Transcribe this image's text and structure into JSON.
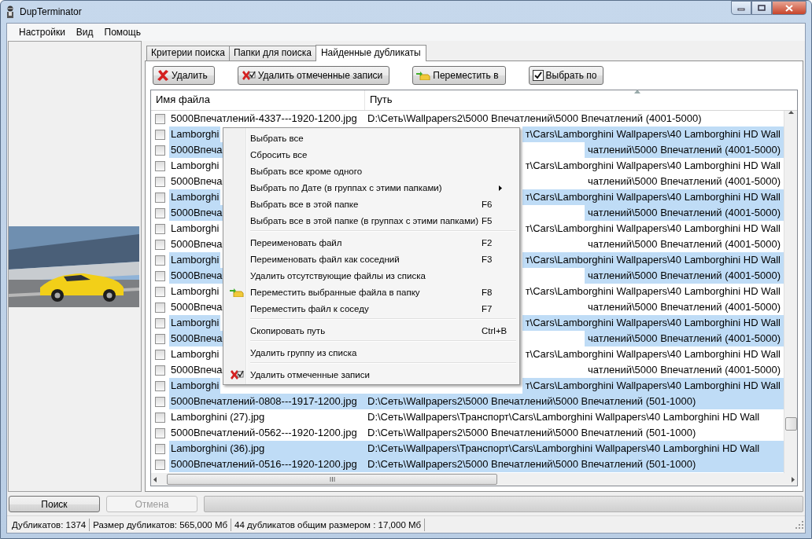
{
  "window": {
    "title": "DupTerminator"
  },
  "menu_bar": [
    "Настройки",
    "Вид",
    "Помощь"
  ],
  "tabs": [
    {
      "label": "Критерии поиска",
      "selected": false
    },
    {
      "label": "Папки для поиска",
      "selected": false
    },
    {
      "label": "Найденные дубликаты",
      "selected": true
    }
  ],
  "toolbar": [
    {
      "label": "Удалить"
    },
    {
      "label": "Удалить отмеченные записи"
    },
    {
      "label": "Переместить в"
    },
    {
      "label": "Выбрать по"
    }
  ],
  "table": {
    "columns": [
      "Имя файла",
      "Путь"
    ],
    "rows": [
      {
        "name": "5000Впечатлений-4337---1920-1200.jpg",
        "path": "D:\\Сеть\\Wallpapers2\\5000 Впечатлений\\5000 Впечатлений (4001-5000)",
        "checked": false,
        "selected": false,
        "covered": false
      },
      {
        "name": "Lamborghi",
        "path": "т\\Cars\\Lamborghini Wallpapers\\40 Lamborghini HD Wall",
        "checked": false,
        "selected": true,
        "covered": true
      },
      {
        "name": "5000Впеча",
        "path": "чатлений\\5000 Впечатлений (4001-5000)",
        "checked": false,
        "selected": true,
        "covered": true
      },
      {
        "name": "Lamborghi",
        "path": "т\\Cars\\Lamborghini Wallpapers\\40 Lamborghini HD Wall",
        "checked": false,
        "selected": false,
        "covered": true
      },
      {
        "name": "5000Впеча",
        "path": "чатлений\\5000 Впечатлений (4001-5000)",
        "checked": false,
        "selected": false,
        "covered": true
      },
      {
        "name": "Lamborghi",
        "path": "т\\Cars\\Lamborghini Wallpapers\\40 Lamborghini HD Wall",
        "checked": false,
        "selected": true,
        "covered": true
      },
      {
        "name": "5000Впеча",
        "path": "чатлений\\5000 Впечатлений (4001-5000)",
        "checked": false,
        "selected": true,
        "covered": true
      },
      {
        "name": "Lamborghi",
        "path": "т\\Cars\\Lamborghini Wallpapers\\40 Lamborghini HD Wall",
        "checked": false,
        "selected": false,
        "covered": true
      },
      {
        "name": "5000Впеча",
        "path": "чатлений\\5000 Впечатлений (4001-5000)",
        "checked": false,
        "selected": false,
        "covered": true
      },
      {
        "name": "Lamborghi",
        "path": "т\\Cars\\Lamborghini Wallpapers\\40 Lamborghini HD Wall",
        "checked": false,
        "selected": true,
        "covered": true
      },
      {
        "name": "5000Впеча",
        "path": "чатлений\\5000 Впечатлений (4001-5000)",
        "checked": false,
        "selected": true,
        "covered": true
      },
      {
        "name": "Lamborghi",
        "path": "т\\Cars\\Lamborghini Wallpapers\\40 Lamborghini HD Wall",
        "checked": false,
        "selected": false,
        "covered": true
      },
      {
        "name": "5000Впеча",
        "path": "чатлений\\5000 Впечатлений (4001-5000)",
        "checked": false,
        "selected": false,
        "covered": true
      },
      {
        "name": "Lamborghi",
        "path": "т\\Cars\\Lamborghini Wallpapers\\40 Lamborghini HD Wall",
        "checked": false,
        "selected": true,
        "covered": true
      },
      {
        "name": "5000Впеча",
        "path": "чатлений\\5000 Впечатлений (4001-5000)",
        "checked": false,
        "selected": true,
        "covered": true
      },
      {
        "name": "Lamborghi",
        "path": "т\\Cars\\Lamborghini Wallpapers\\40 Lamborghini HD Wall",
        "checked": false,
        "selected": false,
        "covered": true
      },
      {
        "name": "5000Впеча",
        "path": "чатлений\\5000 Впечатлений (4001-5000)",
        "checked": false,
        "selected": false,
        "covered": true
      },
      {
        "name": "Lamborghi",
        "path": "т\\Cars\\Lamborghini Wallpapers\\40 Lamborghini HD Wall",
        "checked": false,
        "selected": true,
        "covered": true
      },
      {
        "name": "5000Впечатлений-0808---1917-1200.jpg",
        "path": "D:\\Сеть\\Wallpapers2\\5000 Впечатлений\\5000 Впечатлений (501-1000)",
        "checked": false,
        "selected": true,
        "covered": false
      },
      {
        "name": "Lamborghini (27).jpg",
        "path": "D:\\Сеть\\Wallpapers\\Транспорт\\Cars\\Lamborghini Wallpapers\\40 Lamborghini HD Wall",
        "checked": false,
        "selected": false,
        "covered": false
      },
      {
        "name": "5000Впечатлений-0562---1920-1200.jpg",
        "path": "D:\\Сеть\\Wallpapers2\\5000 Впечатлений\\5000 Впечатлений (501-1000)",
        "checked": false,
        "selected": false,
        "covered": false
      },
      {
        "name": "Lamborghini (36).jpg",
        "path": "D:\\Сеть\\Wallpapers\\Транспорт\\Cars\\Lamborghini Wallpapers\\40 Lamborghini HD Wall",
        "checked": false,
        "selected": true,
        "covered": false
      },
      {
        "name": "5000Впечатлений-0516---1920-1200.jpg",
        "path": "D:\\Сеть\\Wallpapers2\\5000 Впечатлений\\5000 Впечатлений (501-1000)",
        "checked": false,
        "selected": true,
        "covered": false
      }
    ]
  },
  "context_menu": [
    {
      "kind": "item",
      "label": "Выбрать все"
    },
    {
      "kind": "item",
      "label": "Сбросить все"
    },
    {
      "kind": "item",
      "label": "Выбрать все кроме одного"
    },
    {
      "kind": "item",
      "label": "Выбрать по Дате (в группах с этими папками)",
      "submenu": true
    },
    {
      "kind": "item",
      "label": "Выбрать все в этой папке",
      "shortcut": "F6"
    },
    {
      "kind": "item",
      "label": "Выбрать все в этой папке (в группах с этими папками)",
      "shortcut": "F5"
    },
    {
      "kind": "separator"
    },
    {
      "kind": "item",
      "label": "Переименовать файл",
      "shortcut": "F2"
    },
    {
      "kind": "item",
      "label": "Переименовать файл как соседний",
      "shortcut": "F3"
    },
    {
      "kind": "item",
      "label": "Удалить отсутствующие файлы из списка"
    },
    {
      "kind": "item",
      "label": "Переместить выбранные файла в папку",
      "shortcut": "F8"
    },
    {
      "kind": "item",
      "label": "Переместить файл к соседу",
      "shortcut": "F7"
    },
    {
      "kind": "separator"
    },
    {
      "kind": "item",
      "label": "Скопировать путь",
      "shortcut": "Ctrl+B"
    },
    {
      "kind": "separator"
    },
    {
      "kind": "item",
      "label": "Удалить группу из списка"
    },
    {
      "kind": "separator"
    },
    {
      "kind": "item",
      "label": "Удалить отмеченные записи"
    }
  ],
  "preview": {
    "kind": "picture"
  },
  "buttons": [
    {
      "label": "Поиск",
      "disabled": false
    },
    {
      "label": "Отмена",
      "disabled": true
    }
  ],
  "progress": {
    "level": 0
  },
  "status_bar": [
    "Дубликатов: 1374",
    "Размер дубликатов: 565,000 Мб",
    "44 дубликатов общим размером : 17,000 Мб"
  ]
}
